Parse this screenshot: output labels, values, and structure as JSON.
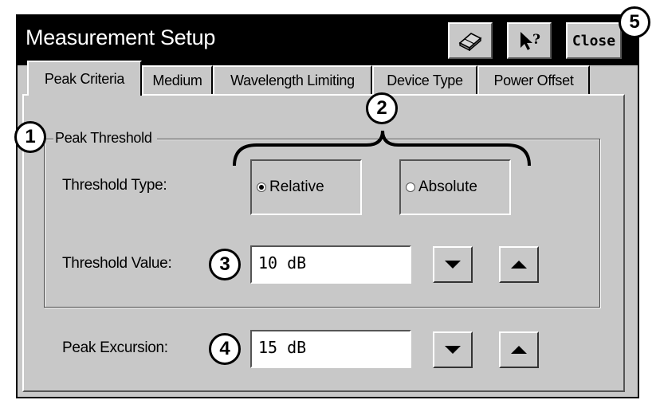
{
  "window": {
    "title": "Measurement Setup",
    "close_label": "Close",
    "icons": [
      "eraser-icon",
      "help-pointer-icon"
    ]
  },
  "tabs": [
    {
      "label": "Peak Criteria",
      "active": true
    },
    {
      "label": "Medium",
      "active": false
    },
    {
      "label": "Wavelength Limiting",
      "active": false
    },
    {
      "label": "Device Type",
      "active": false
    },
    {
      "label": "Power Offset",
      "active": false
    }
  ],
  "peak_threshold": {
    "group_title": "Peak Threshold",
    "threshold_type_label": "Threshold Type:",
    "options": [
      {
        "label": "Relative",
        "selected": true
      },
      {
        "label": "Absolute",
        "selected": false
      }
    ],
    "threshold_value_label": "Threshold Value:",
    "threshold_value": "10 dB"
  },
  "peak_excursion": {
    "label": "Peak Excursion:",
    "value": "15 dB"
  },
  "callouts": [
    "1",
    "2",
    "3",
    "4",
    "5"
  ]
}
